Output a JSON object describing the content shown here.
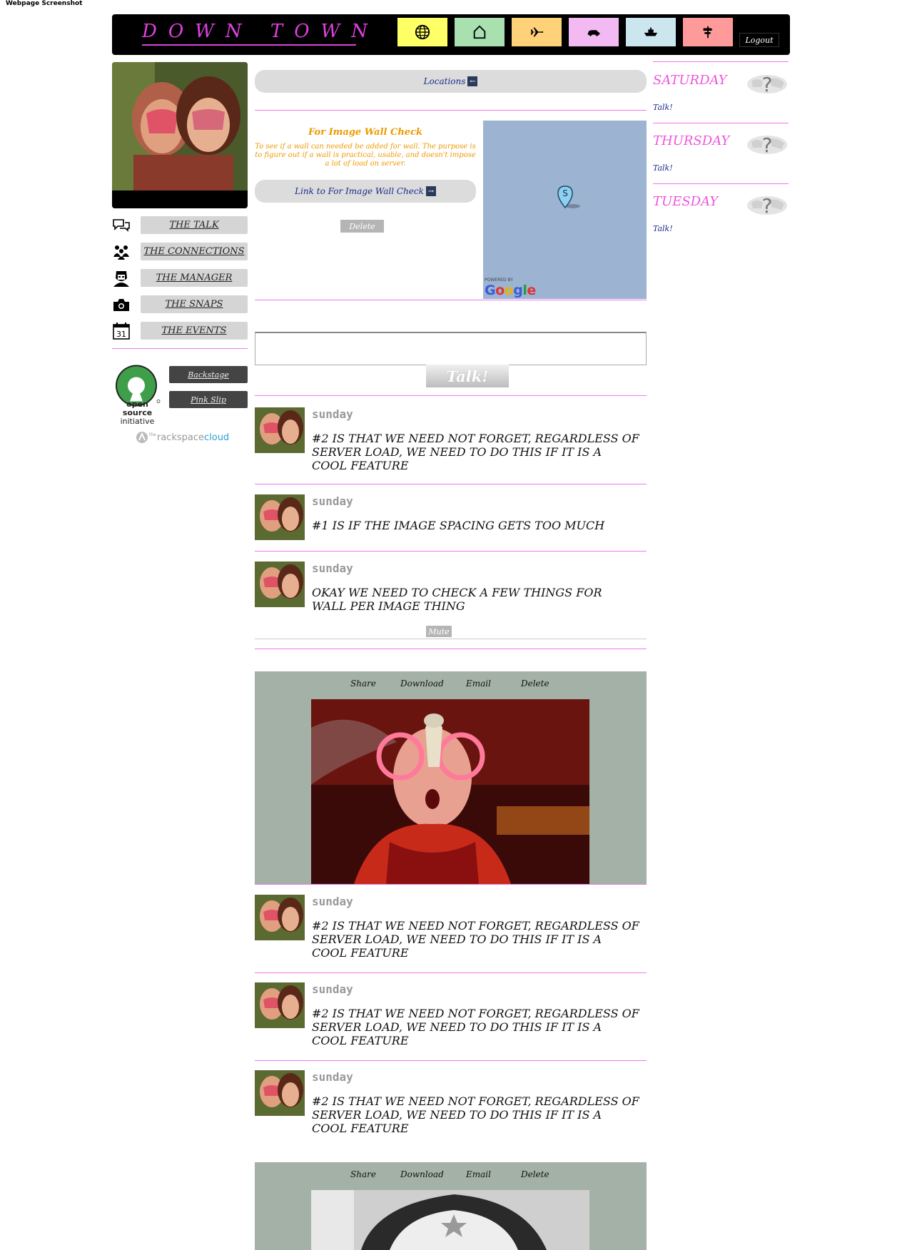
{
  "caption": "Webpage Screenshot",
  "header": {
    "logo": "DOWN TOWN",
    "tabs": [
      {
        "icon": "globe-icon",
        "color": "#ffff66"
      },
      {
        "icon": "house-icon",
        "color": "#a8e0b0"
      },
      {
        "icon": "airplane-icon",
        "color": "#ffd27a"
      },
      {
        "icon": "car-icon",
        "color": "#f2b9f2"
      },
      {
        "icon": "ship-icon",
        "color": "#cce6f0"
      },
      {
        "icon": "signpost-icon",
        "color": "#ff9a9a"
      }
    ],
    "logout": "Logout"
  },
  "sidebar": {
    "items": [
      {
        "icon": "speech-bubbles-icon",
        "label": "THE TALK"
      },
      {
        "icon": "people-icon",
        "label": "THE CONNECTIONS"
      },
      {
        "icon": "manager-icon",
        "label": "THE MANAGER"
      },
      {
        "icon": "camera-icon",
        "label": "THE SNAPS"
      },
      {
        "icon": "calendar-icon",
        "label": "THE EVENTS",
        "calendar_day": "31"
      }
    ],
    "osi": {
      "line1": "open source",
      "line2": "initiative"
    },
    "backstage": "Backstage",
    "pink_slip": "Pink Slip",
    "rackspace": {
      "prefix": "the",
      "name": "rackspace",
      "suffix": "cloud"
    }
  },
  "main": {
    "locations_label": "Locations",
    "check": {
      "title": "For Image Wall Check",
      "text": "To see if a wall can needed be added for wall. The purpose is to figure out if a wall is practical, usable, and doesn't impose a lot of load on server.",
      "link": "Link to For Image Wall Check",
      "delete": "Delete"
    },
    "map": {
      "marker": "S",
      "powered_by": "POWERED BY",
      "google": "Google"
    },
    "talk_button": "Talk!",
    "posts_top": [
      {
        "day": "sunday",
        "text": "#2 is that we need not forget, regardless of server load, we need to do this if it is a cool feature"
      },
      {
        "day": "sunday",
        "text": "#1 is if the image spacing gets too much"
      },
      {
        "day": "sunday",
        "text": "okay we need to check a few things for wall per image thing"
      }
    ],
    "mute": "Mute",
    "gallery_actions": [
      "Share",
      "Download",
      "Email",
      "Delete"
    ],
    "posts_bottom": [
      {
        "day": "sunday",
        "text": "#2 is that we need not forget, regardless of server load, we need to do this if it is a cool feature"
      },
      {
        "day": "sunday",
        "text": "#2 is that we need not forget, regardless of server load, we need to do this if it is a cool feature"
      },
      {
        "day": "sunday",
        "text": "#2 is that we need not forget, regardless of server load, we need to do this if it is a cool feature"
      }
    ]
  },
  "events": [
    {
      "day": "Saturday",
      "talk": "Talk!"
    },
    {
      "day": "Thursday",
      "talk": "Talk!"
    },
    {
      "day": "Tuesday",
      "talk": "Talk!"
    }
  ]
}
